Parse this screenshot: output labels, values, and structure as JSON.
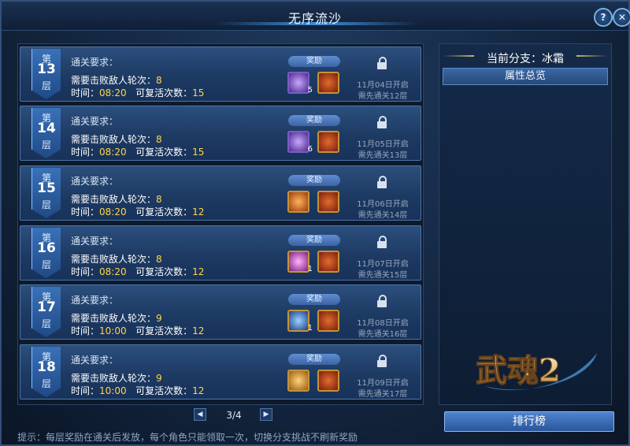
{
  "window": {
    "title": "无序流沙"
  },
  "controls": {
    "help": "?",
    "close": "✕"
  },
  "reward_label": "奖励",
  "req_label": "通关要求：",
  "defeat_prefix": "需要击败敌人轮次：",
  "time_prefix": "时间：",
  "revive_prefix": "可复活次数：",
  "floors": [
    {
      "top": "第",
      "num": "13",
      "bottom": "层",
      "rounds": "8",
      "time": "08:20",
      "revives": "15",
      "reward_icon": "purple-crystal-icon",
      "reward_count": "5",
      "open": "11月04日开启",
      "prev": "需先通关12层"
    },
    {
      "top": "第",
      "num": "14",
      "bottom": "层",
      "rounds": "8",
      "time": "08:20",
      "revives": "15",
      "reward_icon": "purple-crystal-icon",
      "reward_count": "6",
      "open": "11月05日开启",
      "prev": "需先通关13层"
    },
    {
      "top": "第",
      "num": "15",
      "bottom": "层",
      "rounds": "8",
      "time": "08:20",
      "revives": "12",
      "reward_icon": "bag-icon",
      "reward_count": "",
      "open": "11月06日开启",
      "prev": "需先通关14层"
    },
    {
      "top": "第",
      "num": "16",
      "bottom": "层",
      "rounds": "8",
      "time": "08:20",
      "revives": "12",
      "reward_icon": "pink-gem-icon",
      "reward_count": "1",
      "open": "11月07日开启",
      "prev": "需先通关15层"
    },
    {
      "top": "第",
      "num": "17",
      "bottom": "层",
      "rounds": "9",
      "time": "10:00",
      "revives": "12",
      "reward_icon": "moon-icon",
      "reward_count": "1",
      "open": "11月08日开启",
      "prev": "需先通关16层"
    },
    {
      "top": "第",
      "num": "18",
      "bottom": "层",
      "rounds": "9",
      "time": "10:00",
      "revives": "12",
      "reward_icon": "chest-icon",
      "reward_count": "",
      "open": "11月09日开启",
      "prev": "需先通关17层"
    }
  ],
  "pager": {
    "text": "3/4",
    "prev": "◀",
    "next": "▶"
  },
  "tip": "提示：每层奖励在通关后发放，每个角色只能领取一次，切换分支挑战不刷新奖励",
  "right": {
    "branch": "当前分支：冰霜",
    "attr_tab": "属性总览",
    "logo_text": "武魂2",
    "rank_button": "排行榜"
  }
}
